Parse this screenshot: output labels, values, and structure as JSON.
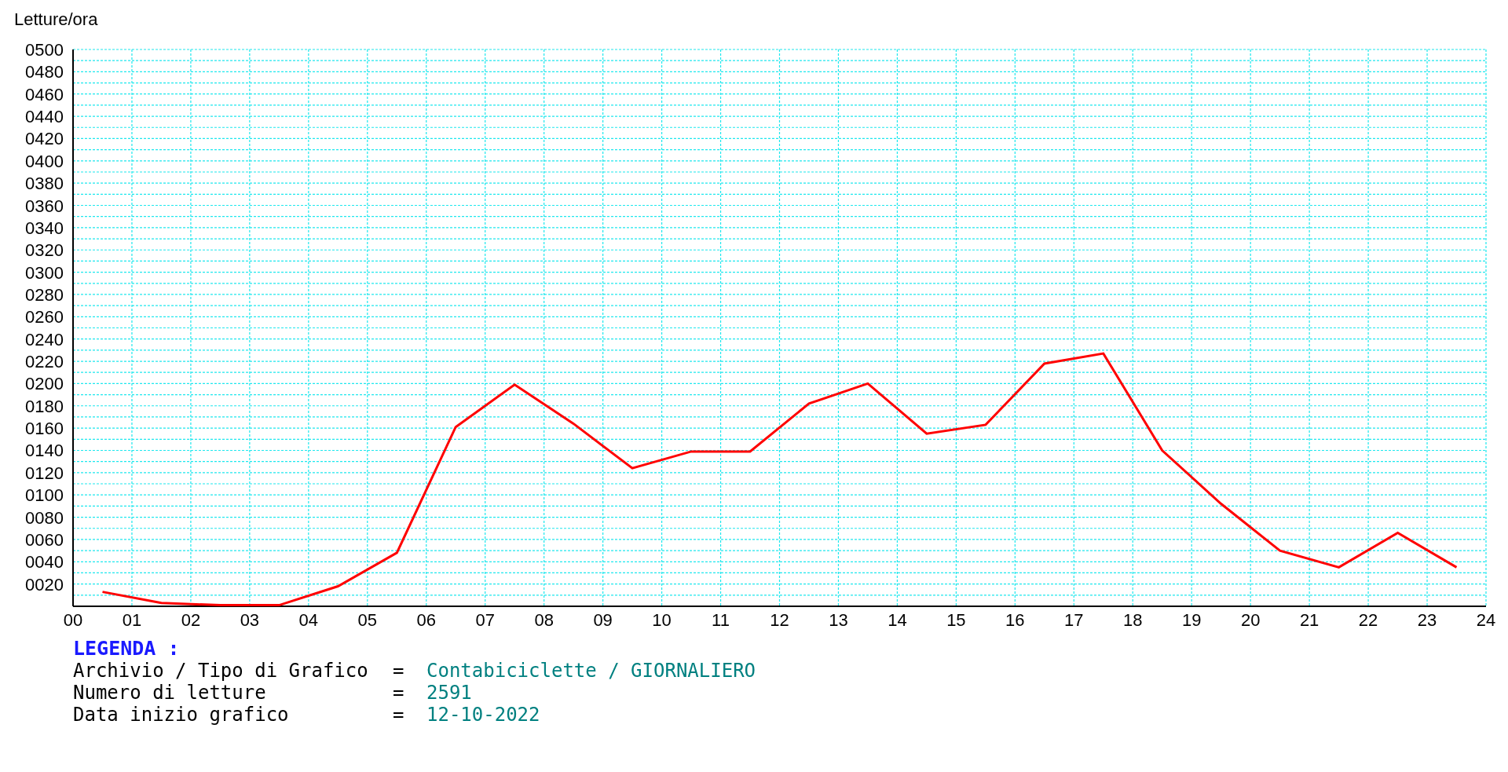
{
  "chart": {
    "chart_data": {
      "type": "line",
      "ylabel": "Letture/ora",
      "x": [
        0.5,
        1.5,
        2.5,
        3.5,
        4.5,
        5.5,
        6.5,
        7.5,
        8.5,
        9.5,
        10.5,
        11.5,
        12.5,
        13.5,
        14.5,
        15.5,
        16.5,
        17.5,
        18.5,
        19.5,
        20.5,
        21.5,
        22.5,
        23.5
      ],
      "grid": true,
      "series": [
        {
          "color": "#ff0000",
          "values": [
            13,
            3,
            1,
            1,
            18,
            48,
            161,
            199,
            164,
            124,
            139,
            139,
            182,
            200,
            155,
            163,
            218,
            227,
            140,
            92,
            50,
            35,
            66,
            35
          ]
        }
      ],
      "xlim": [
        0,
        24
      ],
      "ylim": [
        0,
        500
      ],
      "xticks": [
        {
          "value": 0,
          "label": "00"
        },
        {
          "value": 1,
          "label": "01"
        },
        {
          "value": 2,
          "label": "02"
        },
        {
          "value": 3,
          "label": "03"
        },
        {
          "value": 4,
          "label": "04"
        },
        {
          "value": 5,
          "label": "05"
        },
        {
          "value": 6,
          "label": "06"
        },
        {
          "value": 7,
          "label": "07"
        },
        {
          "value": 8,
          "label": "08"
        },
        {
          "value": 9,
          "label": "09"
        },
        {
          "value": 10,
          "label": "10"
        },
        {
          "value": 11,
          "label": "11"
        },
        {
          "value": 12,
          "label": "12"
        },
        {
          "value": 13,
          "label": "13"
        },
        {
          "value": 14,
          "label": "14"
        },
        {
          "value": 15,
          "label": "15"
        },
        {
          "value": 16,
          "label": "16"
        },
        {
          "value": 17,
          "label": "17"
        },
        {
          "value": 18,
          "label": "18"
        },
        {
          "value": 19,
          "label": "19"
        },
        {
          "value": 20,
          "label": "20"
        },
        {
          "value": 21,
          "label": "21"
        },
        {
          "value": 22,
          "label": "22"
        },
        {
          "value": 23,
          "label": "23"
        },
        {
          "value": 24,
          "label": "24"
        }
      ],
      "yticks": [
        {
          "value": 20,
          "label": "0020"
        },
        {
          "value": 40,
          "label": "0040"
        },
        {
          "value": 60,
          "label": "0060"
        },
        {
          "value": 80,
          "label": "0080"
        },
        {
          "value": 100,
          "label": "0100"
        },
        {
          "value": 120,
          "label": "0120"
        },
        {
          "value": 140,
          "label": "0140"
        },
        {
          "value": 160,
          "label": "0160"
        },
        {
          "value": 180,
          "label": "0180"
        },
        {
          "value": 200,
          "label": "0200"
        },
        {
          "value": 220,
          "label": "0220"
        },
        {
          "value": 240,
          "label": "0240"
        },
        {
          "value": 260,
          "label": "0260"
        },
        {
          "value": 280,
          "label": "0280"
        },
        {
          "value": 300,
          "label": "0300"
        },
        {
          "value": 320,
          "label": "0320"
        },
        {
          "value": 340,
          "label": "0340"
        },
        {
          "value": 360,
          "label": "0360"
        },
        {
          "value": 380,
          "label": "0380"
        },
        {
          "value": 400,
          "label": "0400"
        },
        {
          "value": 420,
          "label": "0420"
        },
        {
          "value": 440,
          "label": "0440"
        },
        {
          "value": 460,
          "label": "0460"
        },
        {
          "value": 480,
          "label": "0480"
        },
        {
          "value": 500,
          "label": "0500"
        }
      ]
    }
  },
  "legend": {
    "title": "LEGENDA :",
    "rows": [
      {
        "label": "Archivio / Tipo di Grafico",
        "separator": "=",
        "value": "Contabiciclette / GIORNALIERO"
      },
      {
        "label": "Numero di letture",
        "separator": "=",
        "value": "2591"
      },
      {
        "label": "Data inizio grafico",
        "separator": "=",
        "value": "12-10-2022"
      }
    ]
  }
}
